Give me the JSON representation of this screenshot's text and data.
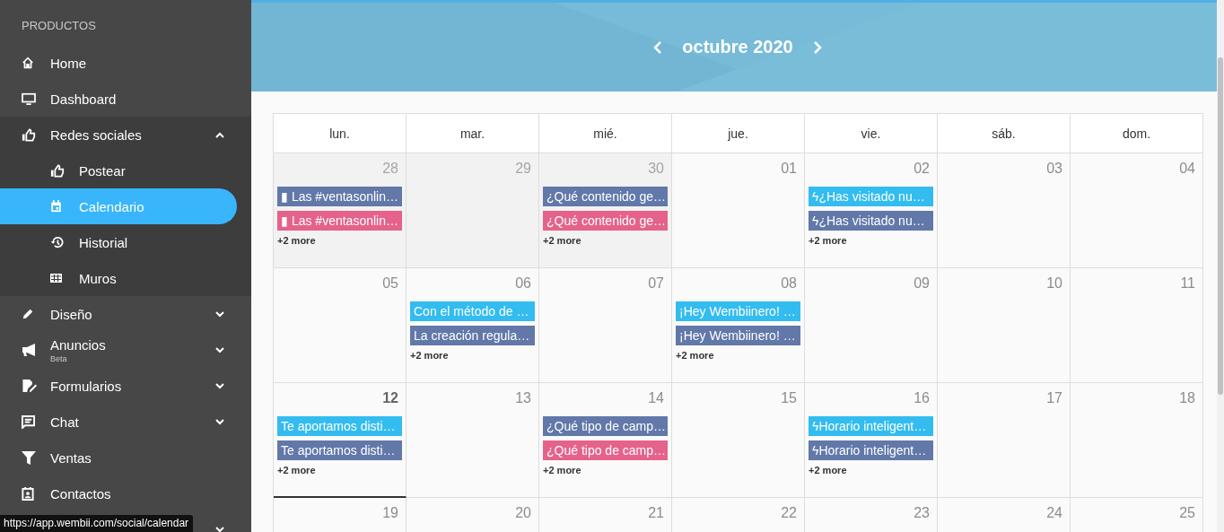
{
  "sidebar": {
    "section_label": "PRODUCTOS",
    "items": [
      {
        "kind": "link",
        "label": "Home"
      },
      {
        "kind": "link",
        "label": "Dashboard"
      },
      {
        "kind": "group",
        "label": "Redes sociales",
        "expanded": true,
        "children": [
          {
            "label": "Postear",
            "selected": false
          },
          {
            "label": "Calendario",
            "selected": true
          },
          {
            "label": "Historial",
            "selected": false
          },
          {
            "label": "Muros",
            "selected": false
          }
        ]
      },
      {
        "kind": "group",
        "label": "Diseño",
        "expanded": false
      },
      {
        "kind": "group",
        "label": "Anuncios",
        "badge": "Beta",
        "expanded": false
      },
      {
        "kind": "group",
        "label": "Formularios",
        "expanded": false
      },
      {
        "kind": "group",
        "label": "Chat",
        "expanded": false
      },
      {
        "kind": "link",
        "label": "Ventas"
      },
      {
        "kind": "link",
        "label": "Contactos"
      },
      {
        "kind": "group",
        "expanded": false
      }
    ]
  },
  "calendar": {
    "title": "octubre 2020",
    "weekdays": [
      "lun.",
      "mar.",
      "mié.",
      "jue.",
      "vie.",
      "sáb.",
      "dom."
    ],
    "weeks": [
      {
        "days": [
          {
            "number": "28",
            "other_month": true,
            "today": false,
            "events": [
              {
                "text": "▮ Las #ventasonlin…",
                "color": "#6178a9"
              },
              {
                "text": "▮ Las #ventasonlin…",
                "color": "#e5628a"
              }
            ],
            "more": "+2 more"
          },
          {
            "number": "29",
            "other_month": true,
            "today": false
          },
          {
            "number": "30",
            "other_month": true,
            "today": false,
            "events": [
              {
                "text": "¿Qué contenido ge…",
                "color": "#6178a9"
              },
              {
                "text": "¿Qué contenido ge…",
                "color": "#e5628a"
              }
            ],
            "more": "+2 more"
          },
          {
            "number": "01",
            "other_month": false,
            "today": false
          },
          {
            "number": "02",
            "other_month": false,
            "today": false,
            "events": [
              {
                "text": "ϟ¿Has visitado nu…",
                "color": "#33bcef"
              },
              {
                "text": "ϟ¿Has visitado nu…",
                "color": "#6178a9"
              }
            ],
            "more": "+2 more"
          },
          {
            "number": "03",
            "other_month": false,
            "today": false
          },
          {
            "number": "04",
            "other_month": false,
            "today": false
          }
        ]
      },
      {
        "days": [
          {
            "number": "05",
            "other_month": false,
            "today": false
          },
          {
            "number": "06",
            "other_month": false,
            "today": false,
            "events": [
              {
                "text": "Con el método de …",
                "color": "#33bcef"
              },
              {
                "text": "La creación regula…",
                "color": "#6178a9"
              }
            ],
            "more": "+2 more"
          },
          {
            "number": "07",
            "other_month": false,
            "today": false
          },
          {
            "number": "08",
            "other_month": false,
            "today": false,
            "events": [
              {
                "text": "¡Hey Wembiinero! …",
                "color": "#33bcef"
              },
              {
                "text": "¡Hey Wembiinero! …",
                "color": "#6178a9"
              }
            ],
            "more": "+2 more"
          },
          {
            "number": "09",
            "other_month": false,
            "today": false
          },
          {
            "number": "10",
            "other_month": false,
            "today": false
          },
          {
            "number": "11",
            "other_month": false,
            "today": false
          }
        ]
      },
      {
        "days": [
          {
            "number": "12",
            "other_month": false,
            "today": true,
            "events": [
              {
                "text": "Te aportamos disti…",
                "color": "#33bcef"
              },
              {
                "text": "Te aportamos disti…",
                "color": "#6178a9"
              }
            ],
            "more": "+2 more"
          },
          {
            "number": "13",
            "other_month": false,
            "today": false
          },
          {
            "number": "14",
            "other_month": false,
            "today": false,
            "events": [
              {
                "text": "¿Qué tipo de camp…",
                "color": "#6178a9"
              },
              {
                "text": "¿Qué tipo de camp…",
                "color": "#e5628a"
              }
            ],
            "more": "+2 more"
          },
          {
            "number": "15",
            "other_month": false,
            "today": false
          },
          {
            "number": "16",
            "other_month": false,
            "today": false,
            "events": [
              {
                "text": "ϟHorario inteligent…",
                "color": "#33bcef"
              },
              {
                "text": "ϟHorario inteligent…",
                "color": "#6178a9"
              }
            ],
            "more": "+2 more"
          },
          {
            "number": "17",
            "other_month": false,
            "today": false
          },
          {
            "number": "18",
            "other_month": false,
            "today": false
          }
        ]
      },
      {
        "days": [
          {
            "number": "19",
            "other_month": false,
            "today": false
          },
          {
            "number": "20",
            "other_month": false,
            "today": false
          },
          {
            "number": "21",
            "other_month": false,
            "today": false
          },
          {
            "number": "22",
            "other_month": false,
            "today": false
          },
          {
            "number": "23",
            "other_month": false,
            "today": false
          },
          {
            "number": "24",
            "other_month": false,
            "today": false
          },
          {
            "number": "25",
            "other_month": false,
            "today": false
          }
        ]
      }
    ]
  },
  "status_url": "https://app.wembii.com/social/calendar"
}
